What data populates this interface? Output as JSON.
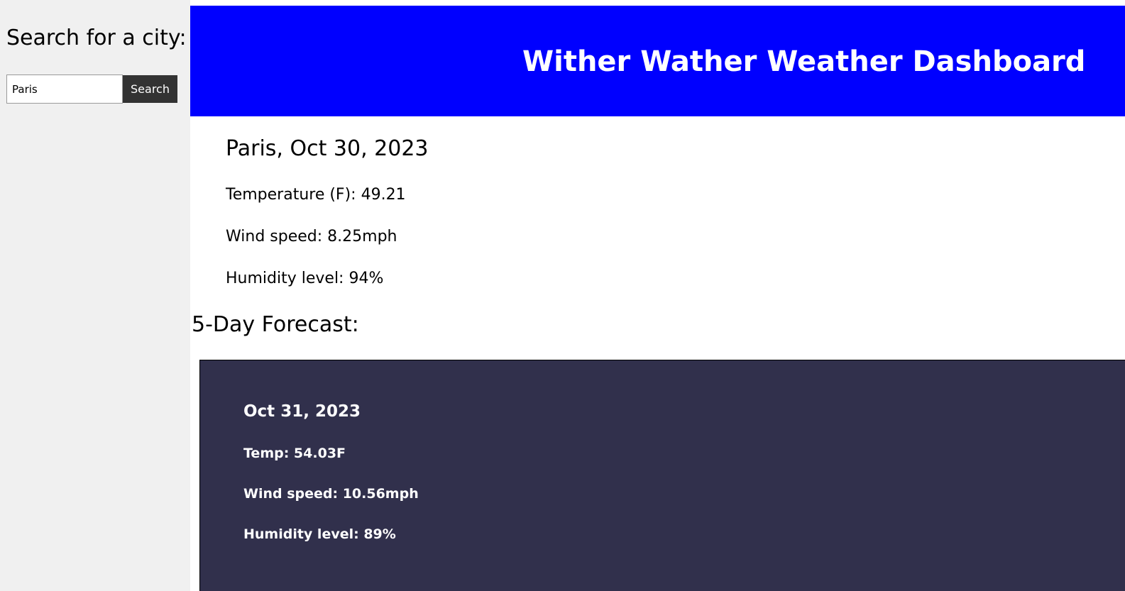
{
  "sidebar": {
    "title": "Search for a city:",
    "search": {
      "value": "Paris",
      "button_label": "Search"
    }
  },
  "header": {
    "title": "Wither Wather Weather Dashboard"
  },
  "current": {
    "heading": "Paris, Oct 30, 2023",
    "temperature": "Temperature (F): 49.21",
    "wind": "Wind speed: 8.25mph",
    "humidity": "Humidity level: 94%"
  },
  "forecast": {
    "heading": "5-Day Forecast:",
    "cards": [
      {
        "date": "Oct 31, 2023",
        "temp": "Temp: 54.03F",
        "wind": "Wind speed: 10.56mph",
        "humidity": "Humidity level: 89%"
      }
    ]
  },
  "colors": {
    "header_bg": "#0000ff",
    "sidebar_bg": "#f0f0f0",
    "card_bg": "#31304c",
    "button_bg": "#333333"
  }
}
